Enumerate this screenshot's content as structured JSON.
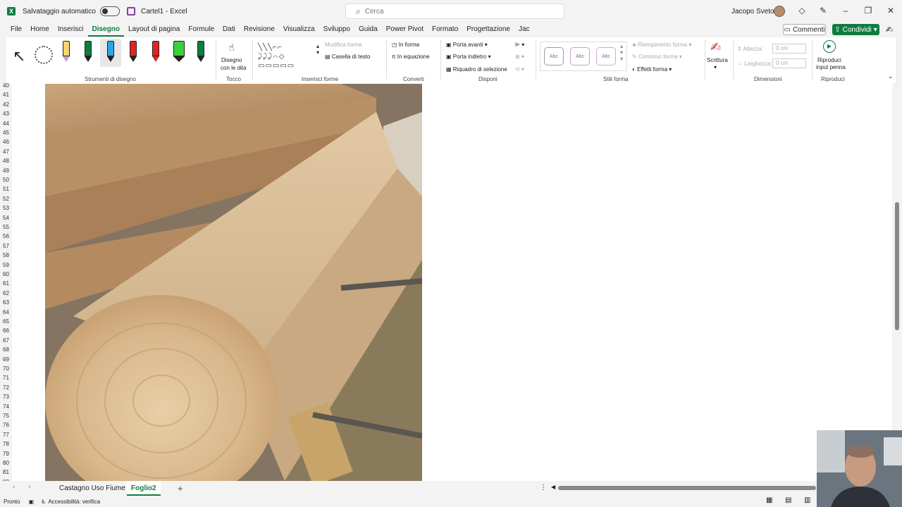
{
  "app": {
    "autosave_label": "Salvataggio automatico",
    "doc_title": "Cartel1 - Excel",
    "search_placeholder": "Cerca",
    "user_name": "Jacopo Svetoni"
  },
  "menu": {
    "items": [
      "File",
      "Home",
      "Inserisci",
      "Disegno",
      "Layout di pagina",
      "Formule",
      "Dati",
      "Revisione",
      "Visualizza",
      "Sviluppo",
      "Guida",
      "Power Pivot",
      "Formato",
      "Progettazione",
      "Jac"
    ],
    "active": "Disegno",
    "comments_label": "Commenti",
    "share_label": "Condividi"
  },
  "ribbon": {
    "groups": {
      "drawing_tools": "Strumenti di disegno",
      "touch": "Tocco",
      "insert_shapes": "Inserisci forme",
      "convert": "Converti",
      "arrange": "Disponi",
      "shape_styles": "Stili forma",
      "dimensions": "Dimensioni",
      "replay": "Riproduci"
    },
    "draw_with_finger_l1": "Disegno",
    "draw_with_finger_l2": "con le dita",
    "edit_shape": "Modifica forma",
    "text_box": "Casella di testo",
    "to_shape": "In forma",
    "to_math": "In equazione",
    "bring_forward": "Porta avanti",
    "send_backward": "Porta indietro",
    "selection_pane": "Riquadro di selezione",
    "style_sample": "Abc",
    "shape_fill": "Riempimento forma",
    "shape_outline": "Contorno forma",
    "shape_effects": "Effetti forma",
    "ink_to_text": "Scrittura",
    "height_label": "Altezza:",
    "width_label": "Larghezza:",
    "height_value": "0 cm",
    "width_value": "0 cm",
    "replay_l1": "Riproduci",
    "replay_l2": "input penna",
    "pen_colors": [
      "#f5d76e",
      "#107c41",
      "#2aa6e8",
      "#e02424",
      "#e02424",
      "#3ad13a",
      "#107c41"
    ]
  },
  "rows": [
    "40",
    "41",
    "42",
    "43",
    "44",
    "45",
    "46",
    "47",
    "48",
    "49",
    "50",
    "51",
    "52",
    "53",
    "54",
    "55",
    "56",
    "57",
    "58",
    "59",
    "60",
    "61",
    "62",
    "63",
    "64",
    "65",
    "66",
    "67",
    "68",
    "69",
    "70",
    "71",
    "72",
    "73",
    "74",
    "75",
    "76",
    "77",
    "78",
    "79",
    "80",
    "81",
    "82"
  ],
  "sheets": {
    "tabs": [
      "Castagno Uso Fiume",
      "Foglio2"
    ],
    "active": "Foglio2"
  },
  "status": {
    "ready": "Pronto",
    "accessibility": "Accessibilità: verifica"
  },
  "colors": {
    "accent": "#107c41"
  }
}
